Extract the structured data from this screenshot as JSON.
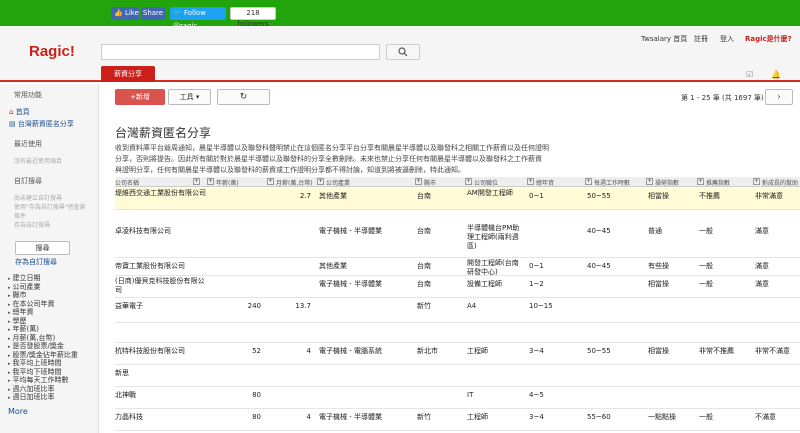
{
  "social": {
    "like": "Like",
    "share": "Share",
    "follow": "Follow @ragic",
    "followers": "218 followers"
  },
  "header": {
    "logo": "Ragic!",
    "links": [
      "Twsalary 首頁",
      "註冊",
      "登入",
      "Ragic是什麼?"
    ],
    "active_tab": "薪資分享"
  },
  "sidebar": {
    "favorites_heading": "常用功能",
    "home": "首頁",
    "sheet": "台灣薪資匿名分享",
    "recent_heading": "最近使用",
    "recent_empty": "沒有最近使用項目",
    "saved_search_heading": "自訂搜尋",
    "saved_search_notes": [
      "尚未建立自訂搜尋",
      "使用\"存為自訂搜尋\"把查詢",
      "條件",
      "存為自訂搜尋"
    ],
    "search_button": "搜尋",
    "save_search_link": "存為自訂搜尋",
    "fields": [
      "建立日期",
      "公司產業",
      "縣市",
      "在本公司年資",
      "總年資",
      "學歷",
      "年薪(萬)",
      "月薪(萬,台幣)",
      "是否發股票/獎金",
      "股票/獎金佔年薪比重",
      "我平均上班時間",
      "我平均下班時間",
      "平均每天工作時數",
      "週六加班比率",
      "週日加班比率"
    ],
    "more": "More"
  },
  "toolbar": {
    "new_button": "+新增",
    "tools_button": "工具",
    "refresh_icon": "refresh-icon",
    "pager": "第 1 - 25 筆 (共 1697 筆)",
    "next_icon": "chevron-right-icon"
  },
  "page": {
    "title": "台灣薪資匿名分享",
    "description_lines": [
      "收到資料庫平台爺周通知，晨星半導體以及聯發科聲明禁止在這個匿名分享平台分享有關晨星半導體以及聯發科之相關工作薪資以及任何證明",
      "分享，否則將提告。因此所有關於對於晨星半導體以及聯發科的分享全數刪除。未來也禁止分享任何有關晨星半導體以及聯發科之工作薪資",
      "與證明分享，任何有關晨星半導體以及聯發科的薪資或工作證明分享都不得討論，知道到將被逼刪除，特此通知。"
    ]
  },
  "table": {
    "columns": [
      "公司名稱",
      "年薪(萬)",
      "月薪(萬,台幣)",
      "公司產業",
      "縣市",
      "公司職位",
      "總年資",
      "每週工作時數",
      "操勞指數",
      "推薦指數",
      "對成長的幫助"
    ],
    "rows": [
      {
        "company": "堤維西交通工業股份有限公司",
        "annual": "",
        "monthly": "2.7",
        "industry": "其他產業",
        "city": "台南",
        "position": "AM開發工程師",
        "years": "0~1",
        "hours": "50~55",
        "stress": "相當操",
        "recommend": "不推薦",
        "growth": "非常滿意"
      },
      {
        "company": "卓凌科技有限公司",
        "annual": "",
        "monthly": "",
        "industry": "電子機械 - 半導體業",
        "city": "台南",
        "position": "半導體機台PM助理工程師(兩利週區)",
        "years": "",
        "hours": "40~45",
        "stress": "普通",
        "recommend": "一般",
        "growth": "滿意"
      },
      {
        "company": "帝寶工業股份有限公司",
        "annual": "",
        "monthly": "",
        "industry": "其他產業",
        "city": "台南",
        "position": "開發工程師(台南研發中心)",
        "years": "0~1",
        "hours": "40~45",
        "stress": "有些操",
        "recommend": "一般",
        "growth": "滿意"
      },
      {
        "company": "(日商)優貝克科技股份有限公司",
        "annual": "",
        "monthly": "",
        "industry": "電子機械 - 半導體業",
        "city": "台南",
        "position": "設備工程師",
        "years": "1~2",
        "hours": "",
        "stress": "相當操",
        "recommend": "一般",
        "growth": "滿意"
      },
      {
        "company": "益華電子",
        "annual": "240",
        "monthly": "13.7",
        "industry": "",
        "city": "新竹",
        "position": "A4",
        "years": "10~15",
        "hours": "",
        "stress": "",
        "recommend": "",
        "growth": ""
      },
      {
        "company": "",
        "annual": "",
        "monthly": "",
        "industry": "",
        "city": "",
        "position": "",
        "years": "",
        "hours": "",
        "stress": "",
        "recommend": "",
        "growth": ""
      },
      {
        "company": "杭特科技股份有限公司",
        "annual": "52",
        "monthly": "4",
        "industry": "電子機械 - 電腦系統",
        "city": "新北市",
        "position": "工程師",
        "years": "3~4",
        "hours": "50~55",
        "stress": "相當操",
        "recommend": "非常不推薦",
        "growth": "非常不滿意"
      },
      {
        "company": "新思",
        "annual": "",
        "monthly": "",
        "industry": "",
        "city": "",
        "position": "",
        "years": "",
        "hours": "",
        "stress": "",
        "recommend": "",
        "growth": ""
      },
      {
        "company": "北神戰",
        "annual": "80",
        "monthly": "",
        "industry": "",
        "city": "",
        "position": "IT",
        "years": "4~5",
        "hours": "",
        "stress": "",
        "recommend": "",
        "growth": ""
      },
      {
        "company": "力晶科技",
        "annual": "80",
        "monthly": "4",
        "industry": "電子機械 - 半導體業",
        "city": "新竹",
        "position": "工程師",
        "years": "3~4",
        "hours": "55~60",
        "stress": "一點點操",
        "recommend": "一般",
        "growth": "不滿意"
      }
    ]
  },
  "colors": {
    "brand_red": "#cc1f1a",
    "social_green": "#22a40b",
    "highlight_row": "#fffbd6"
  }
}
